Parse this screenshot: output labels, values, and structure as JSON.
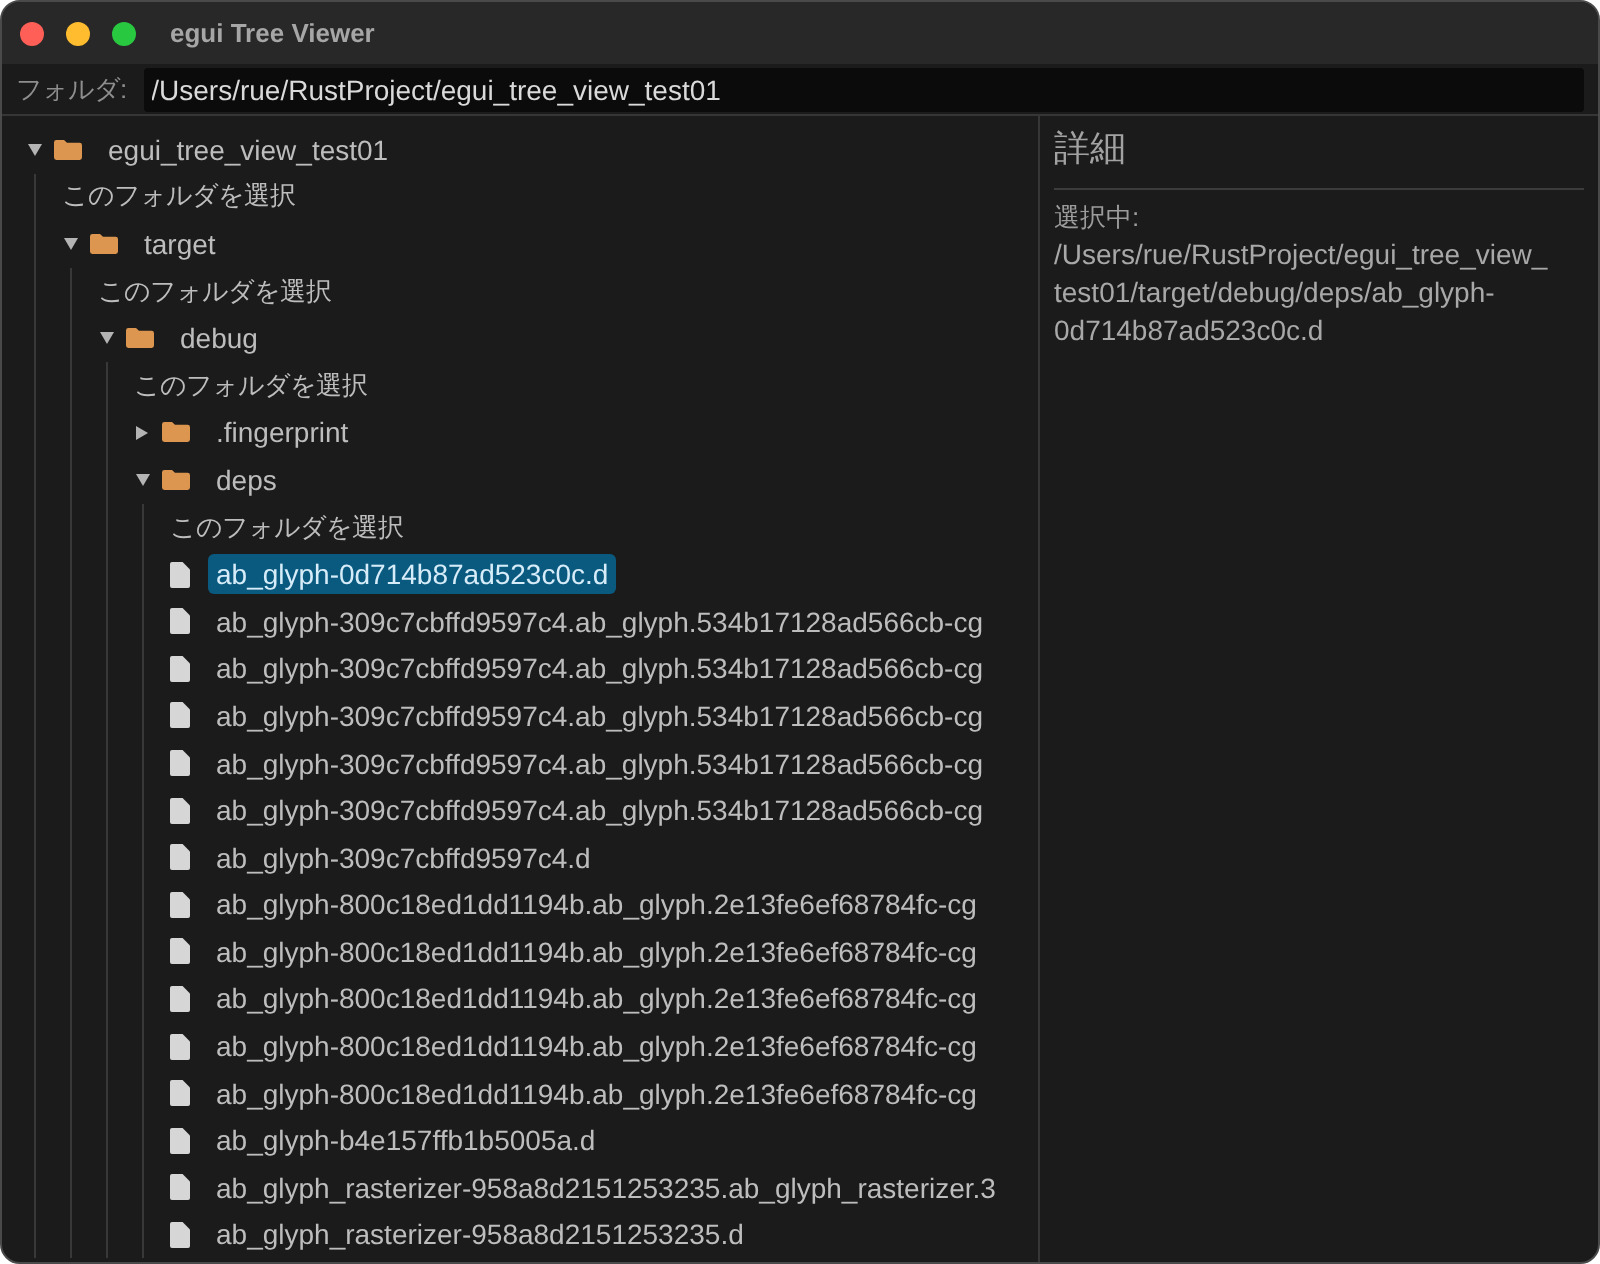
{
  "window": {
    "title": "egui Tree Viewer"
  },
  "folder_bar": {
    "label": "フォルダ:",
    "value": "/Users/rue/RustProject/egui_tree_view_test01"
  },
  "tree": {
    "kind": "folder",
    "name": "egui_tree_view_test01",
    "expanded": true,
    "children": [
      {
        "kind": "select",
        "label": "このフォルダを選択",
        "selected": false
      },
      {
        "kind": "folder",
        "name": "target",
        "expanded": true,
        "children": [
          {
            "kind": "select",
            "label": "このフォルダを選択",
            "selected": false
          },
          {
            "kind": "folder",
            "name": "debug",
            "expanded": true,
            "children": [
              {
                "kind": "select",
                "label": "このフォルダを選択",
                "selected": false
              },
              {
                "kind": "folder",
                "name": ".fingerprint",
                "expanded": false
              },
              {
                "kind": "folder",
                "name": "deps",
                "expanded": true,
                "children": [
                  {
                    "kind": "select",
                    "label": "このフォルダを選択",
                    "selected": false
                  },
                  {
                    "kind": "file",
                    "name": "ab_glyph-0d714b87ad523c0c.d",
                    "selected": true
                  },
                  {
                    "kind": "file",
                    "name": "ab_glyph-309c7cbffd9597c4.ab_glyph.534b17128ad566cb-cg",
                    "selected": false
                  },
                  {
                    "kind": "file",
                    "name": "ab_glyph-309c7cbffd9597c4.ab_glyph.534b17128ad566cb-cg",
                    "selected": false
                  },
                  {
                    "kind": "file",
                    "name": "ab_glyph-309c7cbffd9597c4.ab_glyph.534b17128ad566cb-cg",
                    "selected": false
                  },
                  {
                    "kind": "file",
                    "name": "ab_glyph-309c7cbffd9597c4.ab_glyph.534b17128ad566cb-cg",
                    "selected": false
                  },
                  {
                    "kind": "file",
                    "name": "ab_glyph-309c7cbffd9597c4.ab_glyph.534b17128ad566cb-cg",
                    "selected": false
                  },
                  {
                    "kind": "file",
                    "name": "ab_glyph-309c7cbffd9597c4.d",
                    "selected": false
                  },
                  {
                    "kind": "file",
                    "name": "ab_glyph-800c18ed1dd1194b.ab_glyph.2e13fe6ef68784fc-cg",
                    "selected": false
                  },
                  {
                    "kind": "file",
                    "name": "ab_glyph-800c18ed1dd1194b.ab_glyph.2e13fe6ef68784fc-cg",
                    "selected": false
                  },
                  {
                    "kind": "file",
                    "name": "ab_glyph-800c18ed1dd1194b.ab_glyph.2e13fe6ef68784fc-cg",
                    "selected": false
                  },
                  {
                    "kind": "file",
                    "name": "ab_glyph-800c18ed1dd1194b.ab_glyph.2e13fe6ef68784fc-cg",
                    "selected": false
                  },
                  {
                    "kind": "file",
                    "name": "ab_glyph-800c18ed1dd1194b.ab_glyph.2e13fe6ef68784fc-cg",
                    "selected": false
                  },
                  {
                    "kind": "file",
                    "name": "ab_glyph-b4e157ffb1b5005a.d",
                    "selected": false
                  },
                  {
                    "kind": "file",
                    "name": "ab_glyph_rasterizer-958a8d2151253235.ab_glyph_rasterizer.3",
                    "selected": false
                  },
                  {
                    "kind": "file",
                    "name": "ab_glyph_rasterizer-958a8d2151253235.d",
                    "selected": false
                  }
                ]
              }
            ]
          }
        ]
      }
    ]
  },
  "details": {
    "title": "詳細",
    "selected_label": "選択中:",
    "selected_path": "/Users/rue/RustProject/egui_tree_view_test01/target/debug/deps/ab_glyph-0d714b87ad523c0c.d"
  }
}
